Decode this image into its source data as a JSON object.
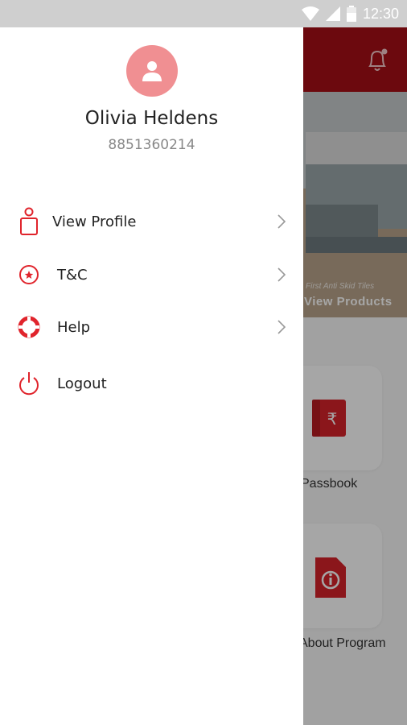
{
  "status_bar": {
    "time": "12:30"
  },
  "background": {
    "banner_tagline": "First Anti Skid Tiles",
    "banner_cta": "View Products",
    "tiles": [
      "Passbook",
      "About Program"
    ]
  },
  "drawer": {
    "user": {
      "name": "Olivia Heldens",
      "phone": "8851360214"
    },
    "menu": [
      {
        "label": "View Profile",
        "icon": "person-outline-icon"
      },
      {
        "label": "T&C",
        "icon": "star-circle-icon"
      },
      {
        "label": "Help",
        "icon": "lifebuoy-icon"
      },
      {
        "label": "Logout",
        "icon": "power-icon"
      }
    ]
  },
  "colors": {
    "brand_red": "#a70f16",
    "icon_red": "#e0242c",
    "avatar_pink": "#f08f92"
  }
}
